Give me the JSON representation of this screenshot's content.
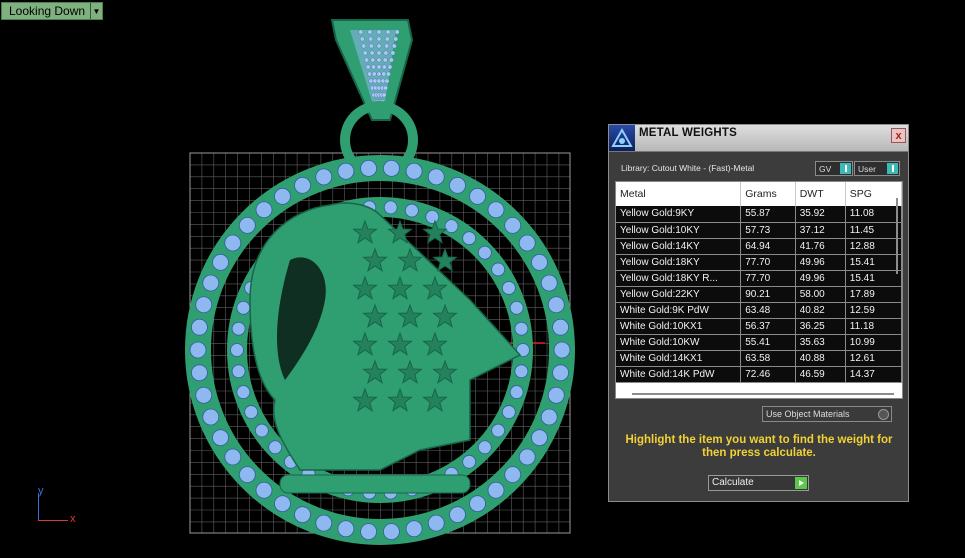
{
  "viewport": {
    "label": "Looking Down",
    "axis_y": "y",
    "axis_x": "x"
  },
  "colors": {
    "background": "#000000",
    "pendant": "#2f9f72",
    "pendant_dark": "#17654a",
    "gem": "#8fb8f0",
    "grid": "#5f5f5f",
    "highlight_text": "#f2d234"
  },
  "panel": {
    "title": "METAL WEIGHTS",
    "close": "x",
    "library": "Library: Cutout White - (Fast)-Metal",
    "toggle_gv": "GV",
    "toggle_user": "User",
    "columns": [
      "Metal",
      "Grams",
      "DWT",
      "SPG"
    ],
    "rows": [
      [
        "Yellow Gold:9KY",
        "55.87",
        "35.92",
        "11.08"
      ],
      [
        "Yellow Gold:10KY",
        "57.73",
        "37.12",
        "11.45"
      ],
      [
        "Yellow Gold:14KY",
        "64.94",
        "41.76",
        "12.88"
      ],
      [
        "Yellow Gold:18KY",
        "77.70",
        "49.96",
        "15.41"
      ],
      [
        "Yellow Gold:18KY R...",
        "77.70",
        "49.96",
        "15.41"
      ],
      [
        "Yellow Gold:22KY",
        "90.21",
        "58.00",
        "17.89"
      ],
      [
        "White Gold:9K PdW",
        "63.48",
        "40.82",
        "12.59"
      ],
      [
        "White Gold:10KX1",
        "56.37",
        "36.25",
        "11.18"
      ],
      [
        "White Gold:10KW",
        "55.41",
        "35.63",
        "10.99"
      ],
      [
        "White Gold:14KX1",
        "63.58",
        "40.88",
        "12.61"
      ],
      [
        "White Gold:14K PdW",
        "72.46",
        "46.59",
        "14.37"
      ]
    ],
    "use_object_materials": "Use Object Materials",
    "message": "Highlight the item you want to find the weight for then press calculate.",
    "calculate": "Calculate"
  }
}
